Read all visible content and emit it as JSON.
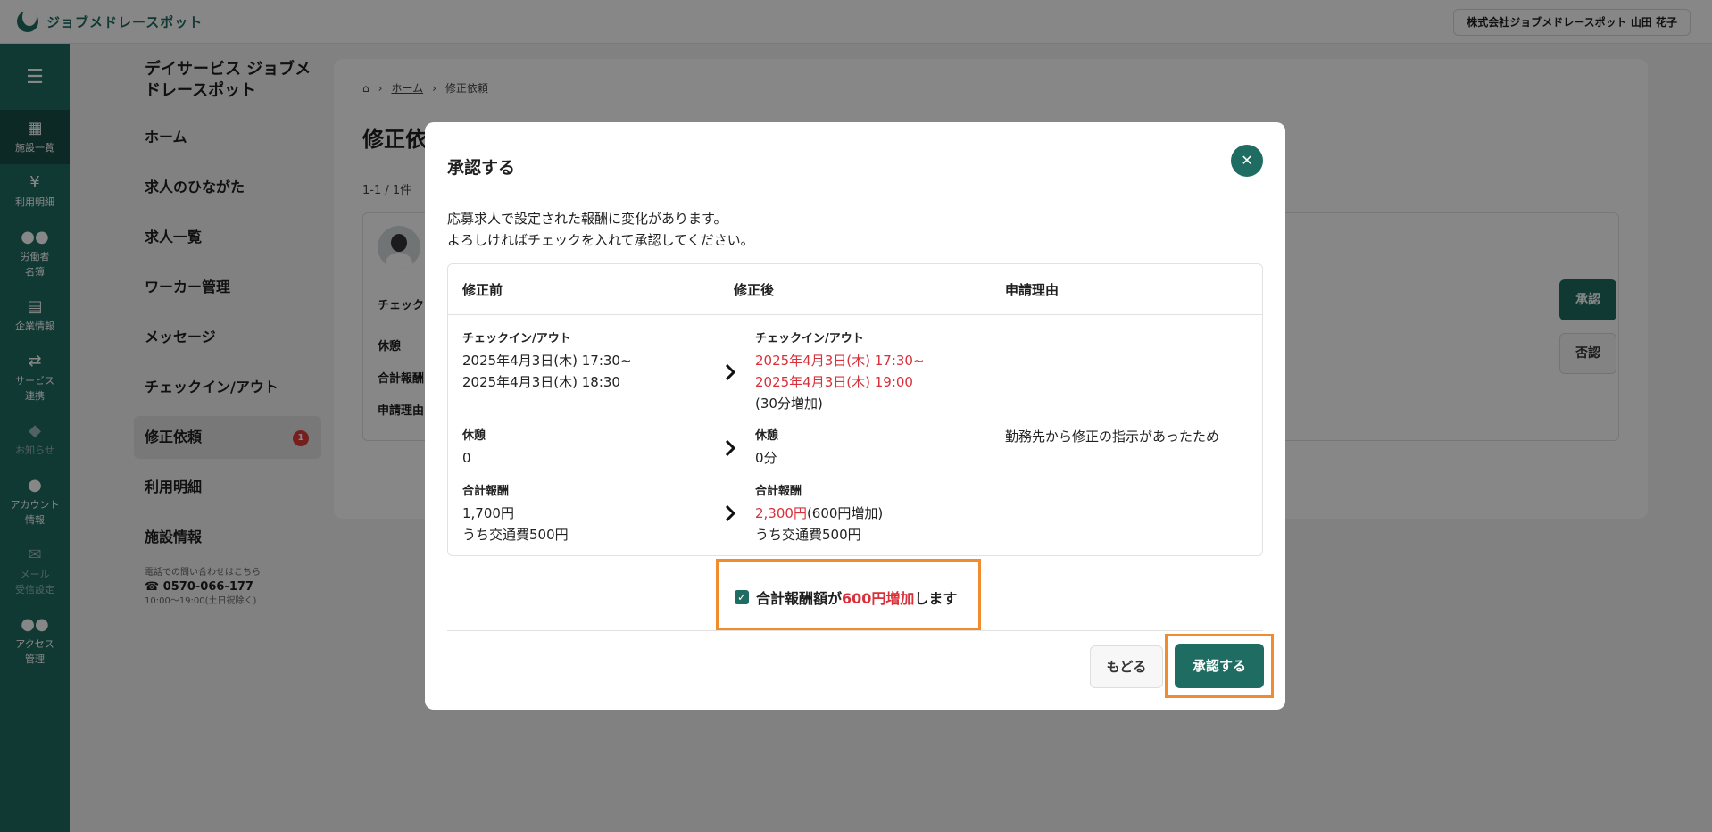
{
  "header": {
    "logo_text": "ジョブメドレースポット",
    "user_label": "株式会社ジョブメドレースポット 山田 花子"
  },
  "leftnav": {
    "items": [
      {
        "label": "施設一覧",
        "icon": "building-icon"
      },
      {
        "label": "利用明細",
        "icon": "yen-icon"
      },
      {
        "label": "労働者\n名簿",
        "icon": "people-icon"
      },
      {
        "label": "企業情報",
        "icon": "document-icon"
      },
      {
        "label": "サービス\n連携",
        "icon": "swap-icon"
      },
      {
        "label": "お知らせ",
        "icon": "bell-icon"
      },
      {
        "label": "アカウント\n情報",
        "icon": "person-icon"
      },
      {
        "label": "メール\n受信設定",
        "icon": "mail-icon"
      },
      {
        "label": "アクセス\n管理",
        "icon": "people-icon"
      }
    ]
  },
  "facility": {
    "title": "デイサービス ジョブメドレースポット",
    "menu": [
      "ホーム",
      "求人のひながた",
      "求人一覧",
      "ワーカー管理",
      "メッセージ",
      "チェックイン/アウト",
      "修正依頼",
      "利用明細",
      "施設情報"
    ],
    "badge_count": "1",
    "contact_label": "電話での問い合わせはこちら",
    "contact_tel": "0570-066-177",
    "contact_hours": "10:00〜19:00(土日祝除く)"
  },
  "main": {
    "breadcrumb_home": "ホーム",
    "breadcrumb_current": "修正依頼",
    "title": "修正依頼",
    "count": "1-1 / 1件",
    "labels": [
      "チェック",
      "休憩",
      "合計報酬",
      "申請理由"
    ],
    "approve": "承認",
    "reject": "否認"
  },
  "modal": {
    "title": "承認する",
    "message_line1": "応募求人で設定された報酬に変化があります。",
    "message_line2": "よろしければチェックを入れて承認してください。",
    "columns": [
      "修正前",
      "修正後",
      "申請理由"
    ],
    "rows": {
      "checkin": {
        "label": "チェックイン/アウト",
        "before_1": "2025年4月3日(木) 17:30~",
        "before_2": "2025年4月3日(木) 18:30",
        "after_1": "2025年4月3日(木) 17:30~",
        "after_2": "2025年4月3日(木) 19:00",
        "after_note": "(30分増加)"
      },
      "break": {
        "label": "休憩",
        "before": "0",
        "after": "0分"
      },
      "reward": {
        "label": "合計報酬",
        "before_1": "1,700円",
        "before_2": "うち交通費500円",
        "after_amount": "2,300円",
        "after_note": "(600円増加)",
        "after_2": "うち交通費500円"
      },
      "reason": "勤務先から修正の指示があったため"
    },
    "confirm_pre": "合計報酬額が",
    "confirm_red": "600円増加",
    "confirm_post": "します",
    "confirm_checked": true,
    "back_label": "もどる",
    "approve_label": "承認する"
  },
  "colors": {
    "brand": "#1f6c62",
    "highlight": "#f08c2e",
    "emphasis_red": "#d9303a"
  }
}
